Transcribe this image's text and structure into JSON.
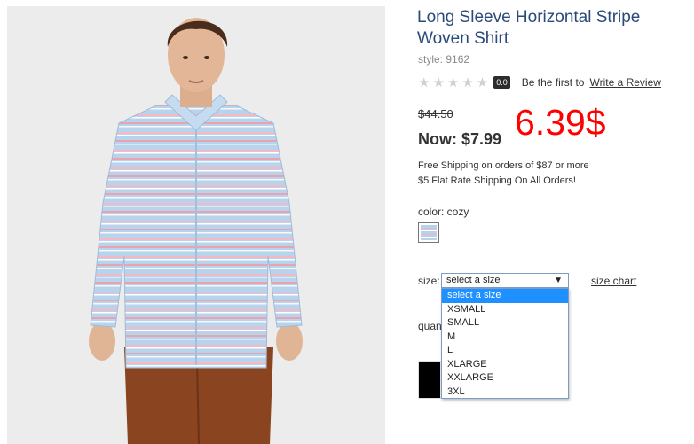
{
  "product": {
    "title": "Long Sleeve Horizontal Stripe Woven Shirt",
    "style": "style: 9162",
    "rating": {
      "stars_filled": 0,
      "stars_total": 5,
      "score": "0.0",
      "first_text": "Be the first to",
      "write_review": "Write a Review"
    },
    "price": {
      "old": "$44.50",
      "now": "Now: $7.99",
      "annotation": "6.39$"
    },
    "shipping": [
      "Free Shipping on orders of $87 or more",
      "$5 Flat Rate Shipping On All Orders!"
    ],
    "color": {
      "label": "color: cozy",
      "swatch": "stripe-swatch"
    },
    "size": {
      "label": "size:",
      "selected": "select a size",
      "options": [
        "select a size",
        "XSMALL",
        "SMALL",
        "M",
        "L",
        "XLARGE",
        "XXLARGE",
        "3XL"
      ],
      "chart_link": "size chart"
    },
    "quantity": {
      "label": "quan"
    }
  },
  "colors": {
    "title": "#2a4a7a",
    "annotation": "#ff0000",
    "dropdown_highlight": "#1e90ff",
    "photo_bg": "#ececec"
  }
}
